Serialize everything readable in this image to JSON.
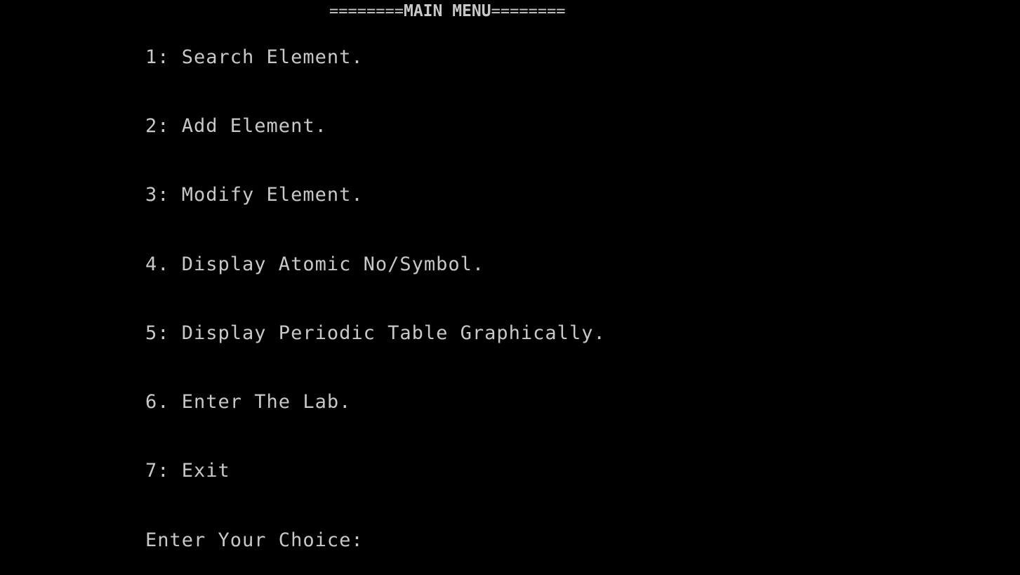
{
  "header": {
    "left_rule": "========",
    "title": "MAIN MENU",
    "right_rule": "========"
  },
  "menu": {
    "items": [
      {
        "label": "1: Search Element."
      },
      {
        "label": "2: Add Element."
      },
      {
        "label": "3: Modify Element."
      },
      {
        "label": "4. Display Atomic No/Symbol."
      },
      {
        "label": "5: Display Periodic Table Graphically."
      },
      {
        "label": "6. Enter The Lab."
      },
      {
        "label": "7: Exit"
      }
    ]
  },
  "prompt": {
    "label": "Enter Your Choice:"
  },
  "colors": {
    "background": "#000000",
    "text": "#c8c8c8"
  }
}
